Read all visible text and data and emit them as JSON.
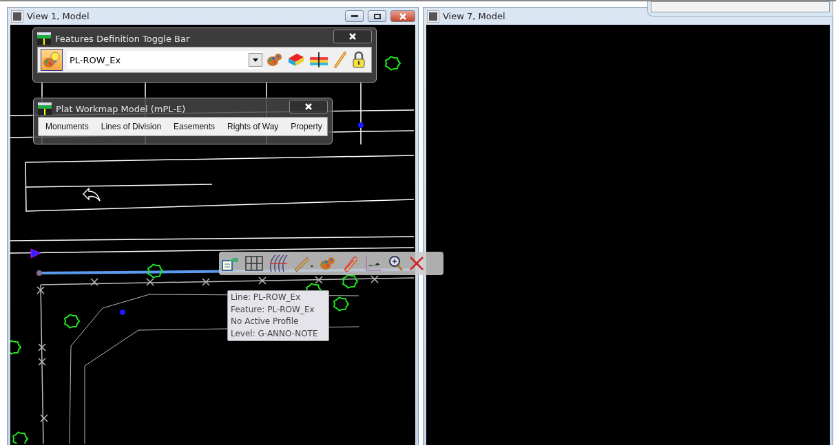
{
  "views": [
    {
      "title": "View 1, Model",
      "kind": "drawing",
      "window_buttons": true
    },
    {
      "title": "View 7, Model",
      "kind": "empty",
      "window_buttons": false
    }
  ],
  "features_toolbar": {
    "title": "Features Definition Toggle Bar",
    "toggle_on": true,
    "feature": "PL-ROW_Ex"
  },
  "plat_toolbar": {
    "title": "Plat Workmap Model (mPL-E)",
    "items": [
      "Monuments",
      "Lines of Division",
      "Easements",
      "Rights of Way",
      "Property"
    ]
  },
  "tooltip": {
    "lines": [
      "Line: PL-ROW_Ex",
      "Feature: PL-ROW_Ex",
      "No Active Profile",
      "Level: G-ANNO-NOTE"
    ]
  }
}
